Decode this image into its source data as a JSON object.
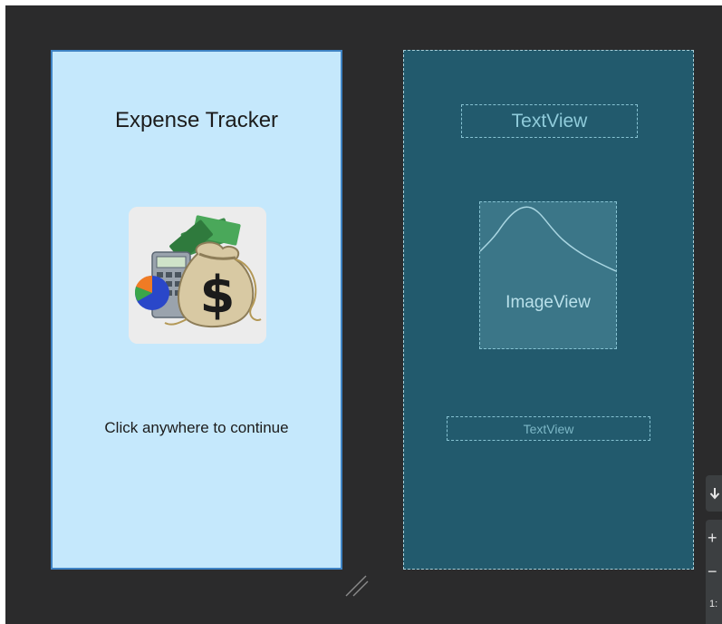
{
  "design": {
    "title": "Expense Tracker",
    "subtitle": "Click anywhere to continue",
    "image_icon": "money-bag-icon"
  },
  "blueprint": {
    "title_placeholder": "TextView",
    "image_placeholder": "ImageView",
    "subtitle_placeholder": "TextView"
  },
  "controls": {
    "pan_icon": "arrow-down-icon",
    "zoom_in": "+",
    "zoom_out": "−",
    "zoom_level": "1:"
  },
  "colors": {
    "design_background": "#c5e8fc",
    "blueprint_background": "#225a6d",
    "canvas_background": "#2b2b2c",
    "selection_border": "#3f83c4"
  }
}
